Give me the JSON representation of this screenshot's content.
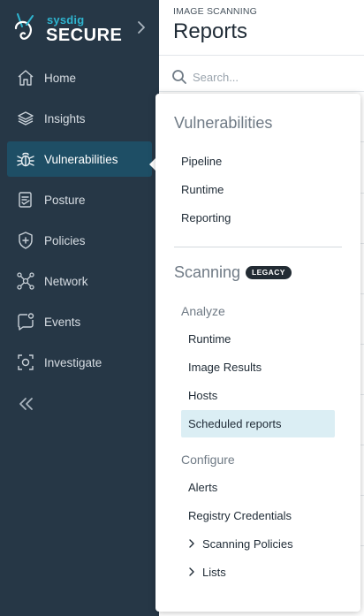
{
  "brand": {
    "name": "sysdig",
    "product": "SECURE"
  },
  "sidebar": {
    "items": [
      {
        "label": "Home",
        "icon": "home-icon"
      },
      {
        "label": "Insights",
        "icon": "insights-icon"
      },
      {
        "label": "Vulnerabilities",
        "icon": "bug-icon",
        "active": true
      },
      {
        "label": "Posture",
        "icon": "posture-icon"
      },
      {
        "label": "Policies",
        "icon": "shield-icon"
      },
      {
        "label": "Network",
        "icon": "network-icon"
      },
      {
        "label": "Events",
        "icon": "events-icon"
      },
      {
        "label": "Investigate",
        "icon": "investigate-icon"
      }
    ]
  },
  "header": {
    "breadcrumb": "IMAGE SCANNING",
    "title": "Reports"
  },
  "search": {
    "placeholder": "Search..."
  },
  "flyout": {
    "vulnerabilities": {
      "title": "Vulnerabilities",
      "items": [
        "Pipeline",
        "Runtime",
        "Reporting"
      ]
    },
    "scanning": {
      "title": "Scanning",
      "badge": "LEGACY",
      "analyze": {
        "label": "Analyze",
        "items": [
          "Runtime",
          "Image Results",
          "Hosts",
          "Scheduled reports"
        ]
      },
      "configure": {
        "label": "Configure",
        "items": [
          "Alerts",
          "Registry Credentials"
        ],
        "expanders": [
          "Scanning Policies",
          "Lists"
        ]
      }
    }
  },
  "colors": {
    "sidebar_bg": "#263746",
    "sidebar_active": "#1e4e65",
    "brand_accent": "#2fb5d0",
    "selected_item_bg": "#dbeef4",
    "badge_bg": "#222b33"
  }
}
